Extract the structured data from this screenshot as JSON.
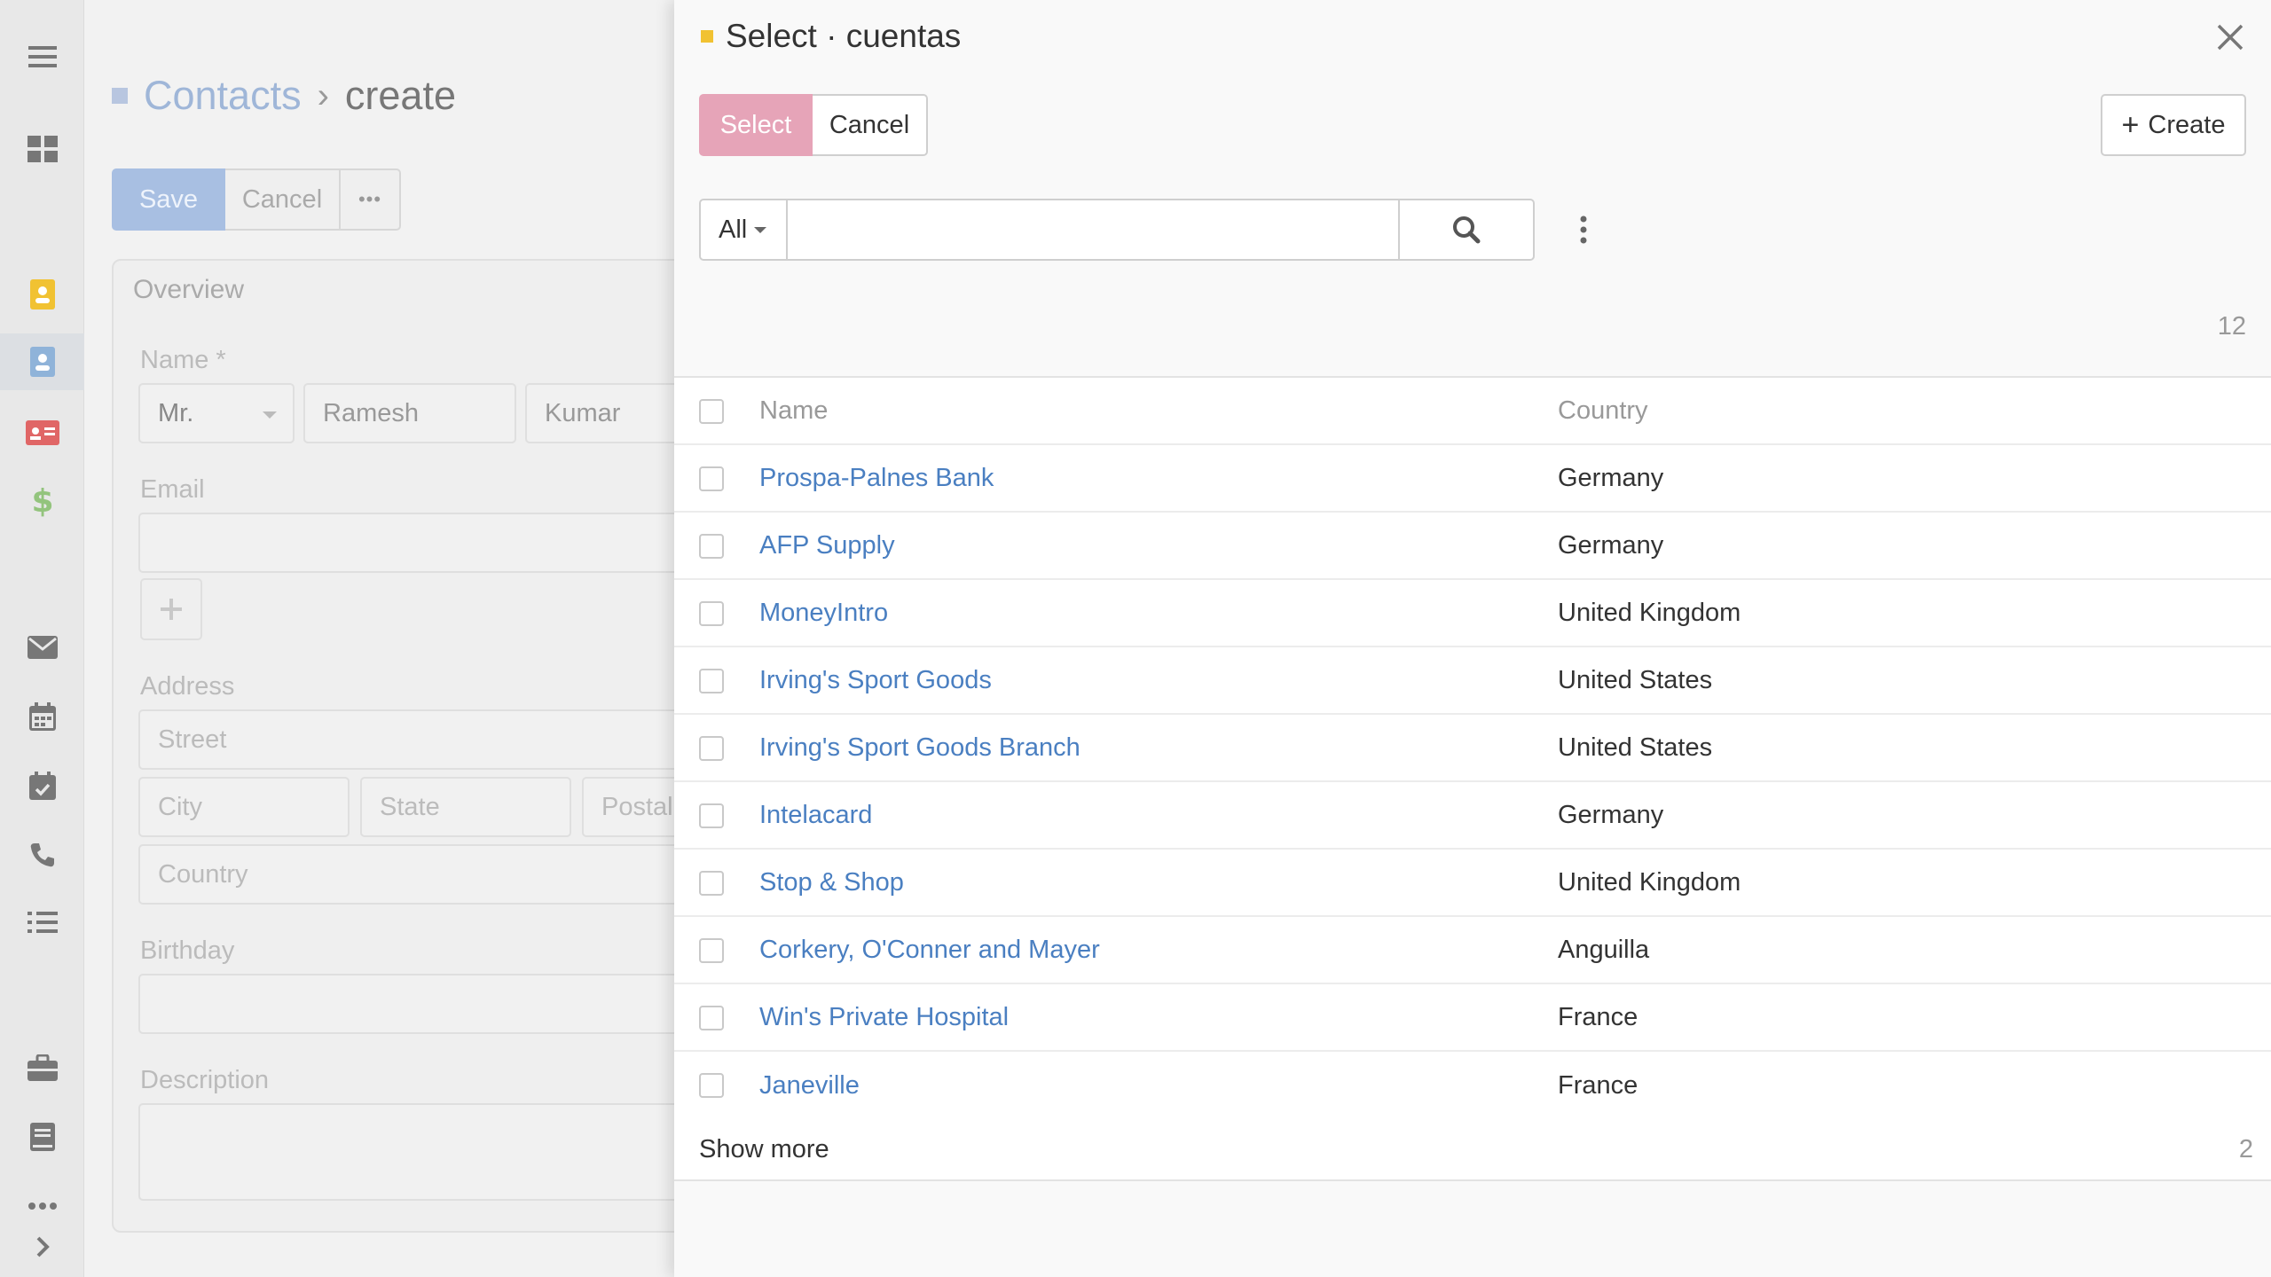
{
  "sidebar": {
    "items": [
      {
        "name": "menu-icon",
        "color": "#777777"
      },
      {
        "name": "dashboard-icon",
        "color": "#777777"
      },
      {
        "name": "contact-book-icon",
        "color": "#f1c232"
      },
      {
        "name": "contacts-icon",
        "color": "#6fa8dc",
        "active": true
      },
      {
        "name": "id-card-icon",
        "color": "#e06666"
      },
      {
        "name": "dollar-icon",
        "color": "#93c47d"
      },
      {
        "name": "mail-icon",
        "color": "#777777"
      },
      {
        "name": "calendar-icon",
        "color": "#777777"
      },
      {
        "name": "calendar-check-icon",
        "color": "#777777"
      },
      {
        "name": "phone-icon",
        "color": "#777777"
      },
      {
        "name": "task-list-icon",
        "color": "#777777"
      },
      {
        "name": "briefcase-icon",
        "color": "#777777"
      },
      {
        "name": "book-icon",
        "color": "#777777"
      },
      {
        "name": "more-icon",
        "color": "#777777"
      },
      {
        "name": "expand-icon",
        "color": "#777777"
      }
    ]
  },
  "page": {
    "breadcrumb": {
      "parent": "Contacts",
      "separator": "›",
      "current": "create"
    },
    "buttons": {
      "save": "Save",
      "cancel": "Cancel",
      "more": "•••"
    },
    "panel": {
      "title": "Overview",
      "name_label": "Name *",
      "salutation": "Mr.",
      "first_name": "Ramesh",
      "last_name": "Kumar",
      "email_label": "Email",
      "address_label": "Address",
      "street_placeholder": "Street",
      "city_placeholder": "City",
      "state_placeholder": "State",
      "postal_placeholder": "Postal",
      "country_placeholder": "Country",
      "birthday_label": "Birthday",
      "description_label": "Description"
    }
  },
  "modal": {
    "title": "Select · cuentas",
    "select_label": "Select",
    "cancel_label": "Cancel",
    "create_label": "Create",
    "filter_label": "All",
    "search_value": "",
    "total_count": "12",
    "columns": {
      "name": "Name",
      "country": "Country"
    },
    "rows": [
      {
        "name": "Prospa-Palnes Bank",
        "country": "Germany"
      },
      {
        "name": "AFP Supply",
        "country": "Germany"
      },
      {
        "name": "MoneyIntro",
        "country": "United Kingdom"
      },
      {
        "name": "Irving's Sport Goods",
        "country": "United States"
      },
      {
        "name": "Irving's Sport Goods Branch",
        "country": "United States"
      },
      {
        "name": "Intelacard",
        "country": "Germany"
      },
      {
        "name": "Stop & Shop",
        "country": "United Kingdom"
      },
      {
        "name": "Corkery, O'Conner and Mayer",
        "country": "Anguilla"
      },
      {
        "name": "Win's Private Hospital",
        "country": "France"
      },
      {
        "name": "Janeville",
        "country": "France"
      }
    ],
    "show_more_label": "Show more",
    "remaining_count": "2"
  },
  "colors": {
    "accent_link": "#4a7fc1",
    "select_button": "#e6a4b8",
    "title_marker": "#f1c232"
  }
}
